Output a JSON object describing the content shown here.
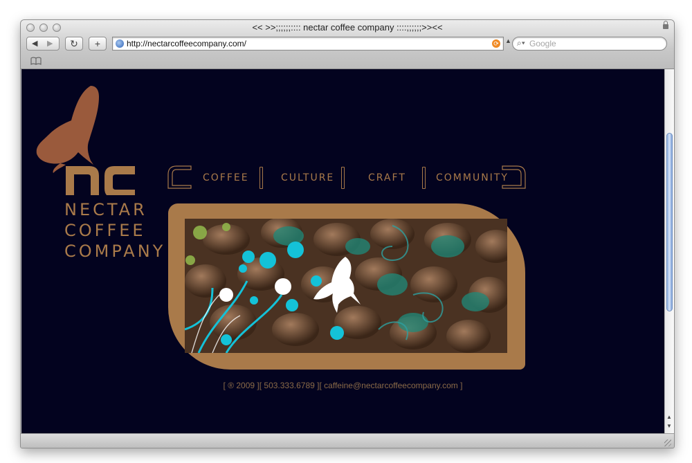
{
  "browser": {
    "title": "<< >>;;;;;;:::: nectar coffee company ::::;;;;;;>><<",
    "url": "http://nectarcoffeecompany.com/",
    "search_placeholder": "Google",
    "back_glyph": "◀",
    "forward_glyph": "▶",
    "reload_glyph": "↻",
    "add_glyph": "+",
    "bookmarks_glyph": "📖",
    "search_glyph": "⌕▾"
  },
  "site": {
    "logo_letters": "nc",
    "wordmark": [
      "NECTAR",
      "COFFEE",
      "COMPANY"
    ],
    "nav": [
      "COFFEE",
      "CULTURE",
      "CRAFT",
      "COMMUNITY"
    ],
    "footer": "[ ® 2009 ][ 503.333.6789 ][ caffeine@nectarcoffeecompany.com ]",
    "colors": {
      "background": "#03031f",
      "accent": "#a97a4a",
      "hummingbird": "#9a5a3c"
    }
  },
  "icons": [
    "globe-icon",
    "rss-icon",
    "lock-icon",
    "search-icon",
    "bookmarks-icon",
    "hummingbird-logo-icon"
  ]
}
